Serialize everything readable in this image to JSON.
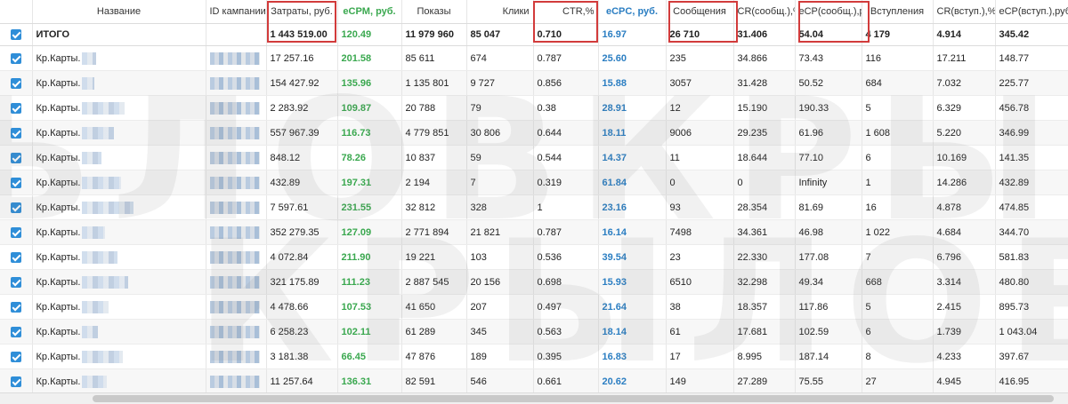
{
  "columns": {
    "check": "",
    "name": "Название",
    "campaign_id": "ID кампании",
    "cost": "Затраты, руб.",
    "ecpm": "eCPM, руб.",
    "impressions": "Показы",
    "clicks": "Клики",
    "ctr": "CTR,%",
    "ecpc": "eCPC, руб.",
    "messages": "Сообщения",
    "cr_msg": "CR(сообщ.),%",
    "ecp_msg": "eCP(сообщ.),руб.",
    "joins": "Вступления",
    "cr_join": "CR(вступ.),%",
    "ecp_join": "eCP(вступ.),руб."
  },
  "total": {
    "label": "ИТОГО",
    "cost": "1 443 519.00",
    "ecpm": "120.49",
    "impressions": "11 979 960",
    "clicks": "85 047",
    "ctr": "0.710",
    "ecpc": "16.97",
    "messages": "26 710",
    "cr_msg": "31.406",
    "ecp_msg": "54.04",
    "joins": "4 179",
    "cr_join": "4.914",
    "ecp_join": "345.42"
  },
  "rows": [
    {
      "name": "Кр.Карты.",
      "cost": "17 257.16",
      "ecpm": "201.58",
      "impressions": "85 611",
      "clicks": "674",
      "ctr": "0.787",
      "ecpc": "25.60",
      "messages": "235",
      "cr_msg": "34.866",
      "ecp_msg": "73.43",
      "joins": "116",
      "cr_join": "17.211",
      "ecp_join": "148.77"
    },
    {
      "name": "Кр.Карты.",
      "cost": "154 427.92",
      "ecpm": "135.96",
      "impressions": "1 135 801",
      "clicks": "9 727",
      "ctr": "0.856",
      "ecpc": "15.88",
      "messages": "3057",
      "cr_msg": "31.428",
      "ecp_msg": "50.52",
      "joins": "684",
      "cr_join": "7.032",
      "ecp_join": "225.77"
    },
    {
      "name": "Кр.Карты.",
      "cost": "2 283.92",
      "ecpm": "109.87",
      "impressions": "20 788",
      "clicks": "79",
      "ctr": "0.38",
      "ecpc": "28.91",
      "messages": "12",
      "cr_msg": "15.190",
      "ecp_msg": "190.33",
      "joins": "5",
      "cr_join": "6.329",
      "ecp_join": "456.78"
    },
    {
      "name": "Кр.Карты.",
      "cost": "557 967.39",
      "ecpm": "116.73",
      "impressions": "4 779 851",
      "clicks": "30 806",
      "ctr": "0.644",
      "ecpc": "18.11",
      "messages": "9006",
      "cr_msg": "29.235",
      "ecp_msg": "61.96",
      "joins": "1 608",
      "cr_join": "5.220",
      "ecp_join": "346.99"
    },
    {
      "name": "Кр.Карты.",
      "cost": "848.12",
      "ecpm": "78.26",
      "impressions": "10 837",
      "clicks": "59",
      "ctr": "0.544",
      "ecpc": "14.37",
      "messages": "11",
      "cr_msg": "18.644",
      "ecp_msg": "77.10",
      "joins": "6",
      "cr_join": "10.169",
      "ecp_join": "141.35"
    },
    {
      "name": "Кр.Карты.",
      "cost": "432.89",
      "ecpm": "197.31",
      "impressions": "2 194",
      "clicks": "7",
      "ctr": "0.319",
      "ecpc": "61.84",
      "messages": "0",
      "cr_msg": "0",
      "ecp_msg": "Infinity",
      "joins": "1",
      "cr_join": "14.286",
      "ecp_join": "432.89"
    },
    {
      "name": "Кр.Карты.",
      "cost": "7 597.61",
      "ecpm": "231.55",
      "impressions": "32 812",
      "clicks": "328",
      "ctr": "1",
      "ecpc": "23.16",
      "messages": "93",
      "cr_msg": "28.354",
      "ecp_msg": "81.69",
      "joins": "16",
      "cr_join": "4.878",
      "ecp_join": "474.85"
    },
    {
      "name": "Кр.Карты.",
      "cost": "352 279.35",
      "ecpm": "127.09",
      "impressions": "2 771 894",
      "clicks": "21 821",
      "ctr": "0.787",
      "ecpc": "16.14",
      "messages": "7498",
      "cr_msg": "34.361",
      "ecp_msg": "46.98",
      "joins": "1 022",
      "cr_join": "4.684",
      "ecp_join": "344.70"
    },
    {
      "name": "Кр.Карты.",
      "cost": "4 072.84",
      "ecpm": "211.90",
      "impressions": "19 221",
      "clicks": "103",
      "ctr": "0.536",
      "ecpc": "39.54",
      "messages": "23",
      "cr_msg": "22.330",
      "ecp_msg": "177.08",
      "joins": "7",
      "cr_join": "6.796",
      "ecp_join": "581.83"
    },
    {
      "name": "Кр.Карты.",
      "cost": "321 175.89",
      "ecpm": "111.23",
      "impressions": "2 887 545",
      "clicks": "20 156",
      "ctr": "0.698",
      "ecpc": "15.93",
      "messages": "6510",
      "cr_msg": "32.298",
      "ecp_msg": "49.34",
      "joins": "668",
      "cr_join": "3.314",
      "ecp_join": "480.80"
    },
    {
      "name": "Кр.Карты.",
      "cost": "4 478.66",
      "ecpm": "107.53",
      "impressions": "41 650",
      "clicks": "207",
      "ctr": "0.497",
      "ecpc": "21.64",
      "messages": "38",
      "cr_msg": "18.357",
      "ecp_msg": "117.86",
      "joins": "5",
      "cr_join": "2.415",
      "ecp_join": "895.73"
    },
    {
      "name": "Кр.Карты.",
      "cost": "6 258.23",
      "ecpm": "102.11",
      "impressions": "61 289",
      "clicks": "345",
      "ctr": "0.563",
      "ecpc": "18.14",
      "messages": "61",
      "cr_msg": "17.681",
      "ecp_msg": "102.59",
      "joins": "6",
      "cr_join": "1.739",
      "ecp_join": "1 043.04"
    },
    {
      "name": "Кр.Карты.",
      "cost": "3 181.38",
      "ecpm": "66.45",
      "impressions": "47 876",
      "clicks": "189",
      "ctr": "0.395",
      "ecpc": "16.83",
      "messages": "17",
      "cr_msg": "8.995",
      "ecp_msg": "187.14",
      "joins": "8",
      "cr_join": "4.233",
      "ecp_join": "397.67"
    },
    {
      "name": "Кр.Карты.",
      "cost": "11 257.64",
      "ecpm": "136.31",
      "impressions": "82 591",
      "clicks": "546",
      "ctr": "0.661",
      "ecpc": "20.62",
      "messages": "149",
      "cr_msg": "27.289",
      "ecp_msg": "75.55",
      "joins": "27",
      "cr_join": "4.945",
      "ecp_join": "416.95"
    }
  ],
  "colors": {
    "green": "#3aa84f",
    "blue": "#2b7ec2",
    "highlight": "#d23b3b",
    "checkbox": "#2f8ed8"
  }
}
